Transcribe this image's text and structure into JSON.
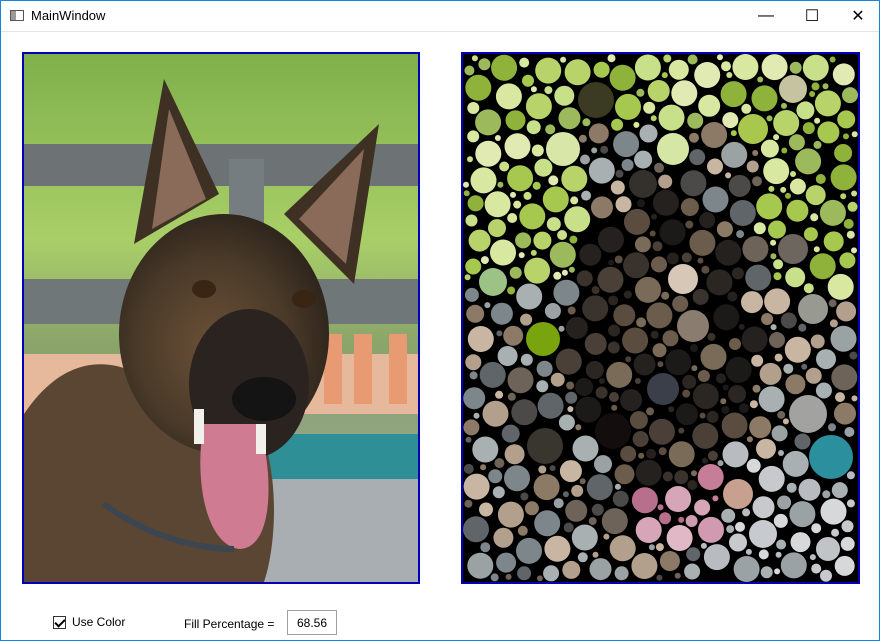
{
  "window": {
    "title": "MainWindow",
    "controls": {
      "minimize": "—",
      "maximize": "☐",
      "close": "✕"
    }
  },
  "images": {
    "original": "dog-photo",
    "mosaic": "circle-mosaic"
  },
  "controls": {
    "use_color_label": "Use Color",
    "use_color_checked": true,
    "fill_label": "Fill Percentage =",
    "fill_value": "68.56"
  },
  "colors": {
    "frame_border": "#0000b8",
    "window_border": "#1883d7"
  }
}
